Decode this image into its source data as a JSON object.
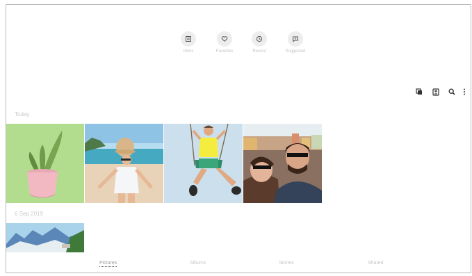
{
  "quick_actions": [
    {
      "label": "Items",
      "icon": "album-icon"
    },
    {
      "label": "Favorites",
      "icon": "heart-icon"
    },
    {
      "label": "Recent",
      "icon": "clock-icon"
    },
    {
      "label": "Suggested",
      "icon": "suggest-icon"
    }
  ],
  "toolbar": {
    "icons": [
      "select-icon",
      "create-icon",
      "search-icon",
      "more-icon"
    ]
  },
  "sections": {
    "today_label": "Today",
    "date_label": "6 Sep 2019"
  },
  "tabs": [
    {
      "label": "Pictures",
      "active": true
    },
    {
      "label": "Albums",
      "active": false
    },
    {
      "label": "Stories",
      "active": false
    },
    {
      "label": "Shared",
      "active": false
    }
  ]
}
